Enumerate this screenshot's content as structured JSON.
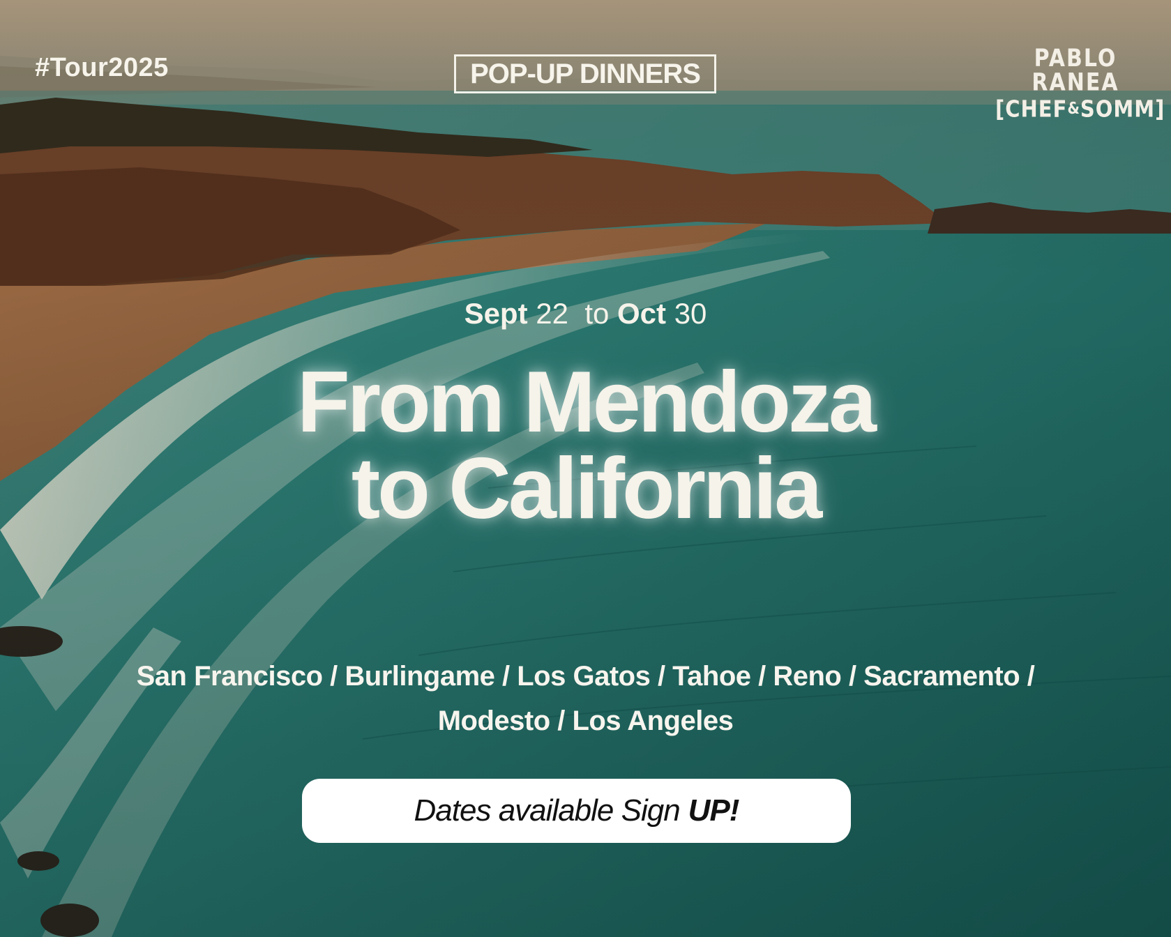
{
  "header": {
    "hashtag": "#Tour2025",
    "badge": "POP-UP DINNERS",
    "brand_name": "PABLO RANEA",
    "brand_sub_left": "[CHEF",
    "brand_sub_amp": "&",
    "brand_sub_right": "SOMM]"
  },
  "dates": {
    "start_month": "Sept",
    "start_day": "22",
    "to": "to",
    "end_month": "Oct",
    "end_day": "30"
  },
  "headline": {
    "line1": "From Mendoza",
    "line2": "to California"
  },
  "cities": {
    "line1": "San Francisco / Burlingame / Los Gatos / Tahoe / Reno / Sacramento /",
    "line2": "Modesto / Los Angeles"
  },
  "cta": {
    "text": "Dates available Sign",
    "emphasis": "UP!"
  },
  "colors": {
    "sea": "#1f6a63",
    "sand": "#8a5a36",
    "cliff": "#5a3520",
    "sky": "#a8957a",
    "text": "#f5f3ea",
    "button": "#ffffff"
  }
}
